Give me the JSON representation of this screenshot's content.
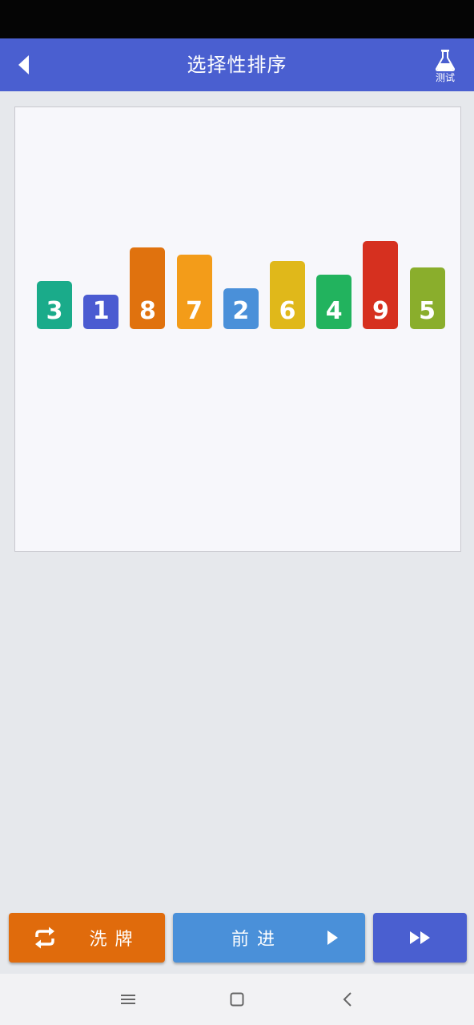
{
  "app_bar": {
    "title": "选择性排序",
    "test_label": "测试",
    "color": "#4a5fd0"
  },
  "bars": [
    {
      "value": "3",
      "color": "#1aab8a"
    },
    {
      "value": "1",
      "color": "#4b5bd1"
    },
    {
      "value": "8",
      "color": "#e0720e"
    },
    {
      "value": "7",
      "color": "#f39c19"
    },
    {
      "value": "2",
      "color": "#4a90d9"
    },
    {
      "value": "6",
      "color": "#e0b81a"
    },
    {
      "value": "4",
      "color": "#22b35e"
    },
    {
      "value": "9",
      "color": "#d6301f"
    },
    {
      "value": "5",
      "color": "#8aae2c"
    }
  ],
  "controls": {
    "shuffle_label": "洗牌",
    "forward_label": "前进",
    "shuffle_icon": "repeat-icon",
    "forward_icon": "play-icon",
    "fast_forward_icon": "fast-forward-icon"
  },
  "nav": {
    "menu_icon": "menu-icon",
    "home_icon": "home-square-icon",
    "back_icon": "chevron-left-icon"
  }
}
